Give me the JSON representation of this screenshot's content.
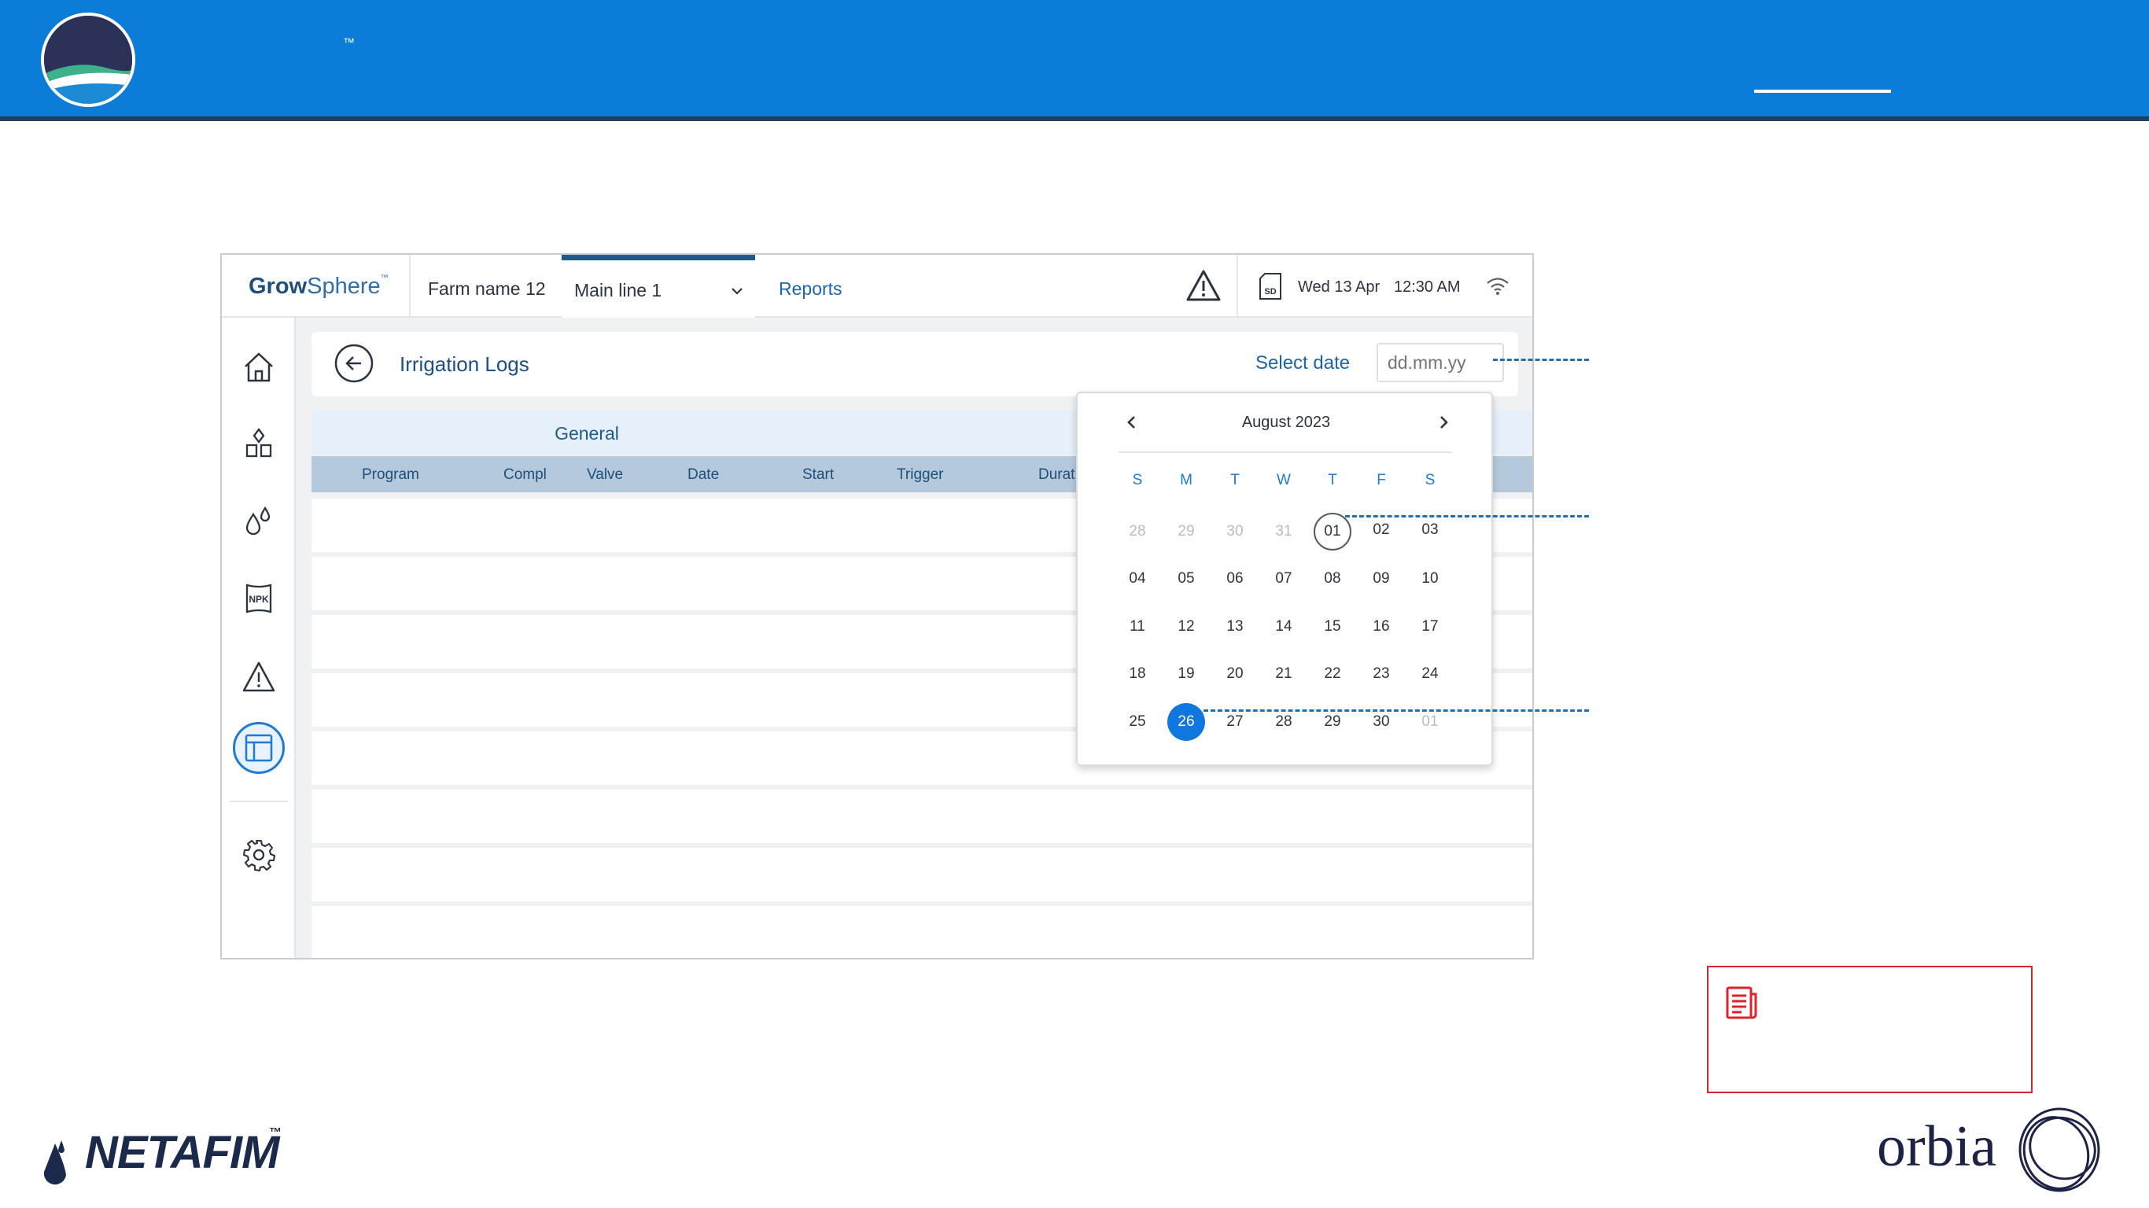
{
  "banner": {
    "tm": "™",
    "accent_color": "#0b7dd8"
  },
  "app": {
    "brand_bold": "Grow",
    "brand_thin": "Sphere",
    "brand_tm": "™",
    "farm_name": "Farm name 12",
    "main_line": "Main line 1",
    "reports_tab": "Reports",
    "date": "Wed 13 Apr",
    "time": "12:30 AM",
    "sd_label": "SD",
    "npk_label": "NPK",
    "page_title": "Irrigation Logs",
    "select_date_label": "Select date",
    "date_placeholder": "dd.mm.yy",
    "table": {
      "group_label": "General",
      "columns": [
        "Program",
        "Compl",
        "Valve",
        "Date",
        "Start",
        "Trigger",
        "Durat"
      ]
    },
    "calendar": {
      "month_label": "August 2023",
      "weekdays": [
        "S",
        "M",
        "T",
        "W",
        "T",
        "F",
        "S"
      ],
      "weeks": [
        [
          "28",
          "29",
          "30",
          "31",
          "01",
          "02",
          "03"
        ],
        [
          "04",
          "05",
          "06",
          "07",
          "08",
          "09",
          "10"
        ],
        [
          "11",
          "12",
          "13",
          "14",
          "15",
          "16",
          "17"
        ],
        [
          "18",
          "19",
          "20",
          "21",
          "22",
          "23",
          "24"
        ],
        [
          "25",
          "26",
          "27",
          "28",
          "29",
          "30",
          "01"
        ]
      ],
      "today": "01",
      "selected": "26",
      "selected_color": "#1076e0"
    }
  },
  "logos": {
    "netafim": "NETAFIM",
    "netafim_tm": "™",
    "orbia": "orbia"
  },
  "note_color": "#d9262c"
}
